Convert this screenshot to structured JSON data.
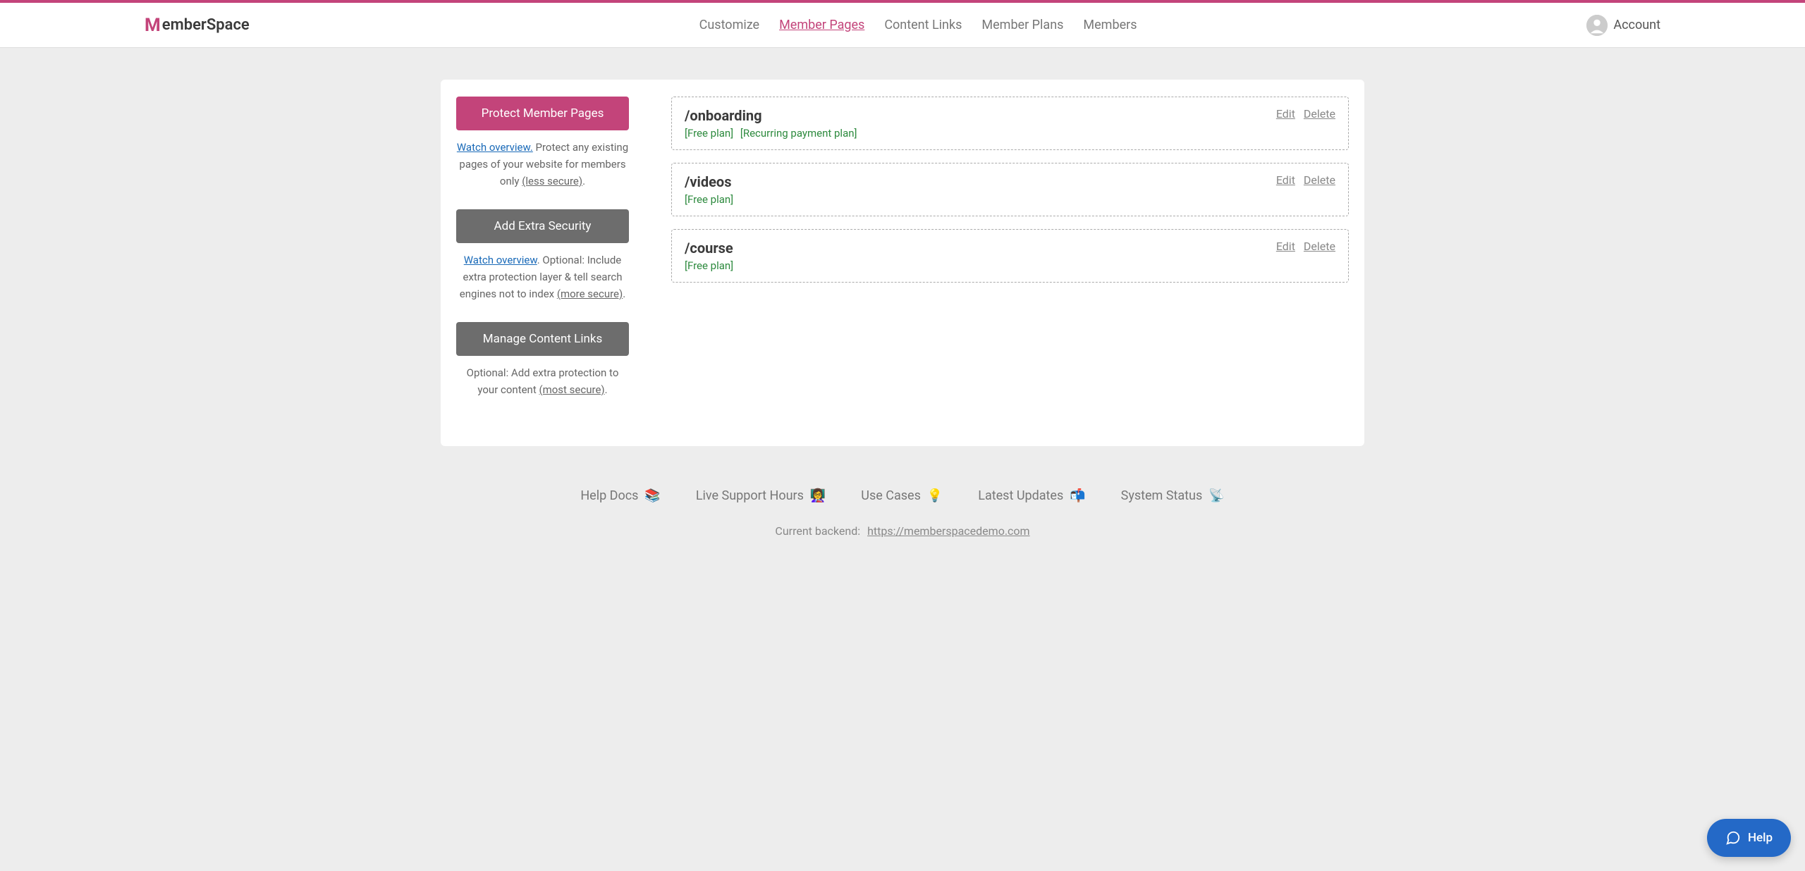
{
  "brand": "MemberSpace",
  "nav": {
    "customize": "Customize",
    "member_pages": "Member Pages",
    "content_links": "Content Links",
    "member_plans": "Member Plans",
    "members": "Members"
  },
  "account_label": "Account",
  "sidebar": {
    "protect": {
      "button": "Protect Member Pages",
      "link": "Watch overview.",
      "text_1": " Protect any existing pages of your website for members only ",
      "secure": "(less secure)",
      "period": "."
    },
    "extra_security": {
      "button": "Add Extra Security",
      "link": "Watch overview",
      "text_1": ". Optional: Include extra protection layer & tell search engines not to index ",
      "secure": "(more secure)",
      "period": "."
    },
    "content_links": {
      "button": "Manage Content Links",
      "text_1": "Optional: Add extra protection to your content ",
      "secure": "(most secure)",
      "period": "."
    }
  },
  "pages": [
    {
      "path": "/onboarding",
      "plans": [
        "[Free plan]",
        "[Recurring payment plan]"
      ]
    },
    {
      "path": "/videos",
      "plans": [
        "[Free plan]"
      ]
    },
    {
      "path": "/course",
      "plans": [
        "[Free plan]"
      ]
    }
  ],
  "page_actions": {
    "edit": "Edit",
    "delete": "Delete"
  },
  "footer": {
    "help_docs": "Help Docs",
    "live_support": "Live Support Hours",
    "use_cases": "Use Cases",
    "latest_updates": "Latest Updates",
    "system_status": "System Status",
    "backend_label": "Current backend:",
    "backend_url": "https://memberspacedemo.com"
  },
  "help_widget": "Help",
  "emojis": {
    "books": "📚",
    "teacher": "👩‍🏫",
    "bulb": "💡",
    "mailbox": "📬",
    "satellite": "📡"
  }
}
